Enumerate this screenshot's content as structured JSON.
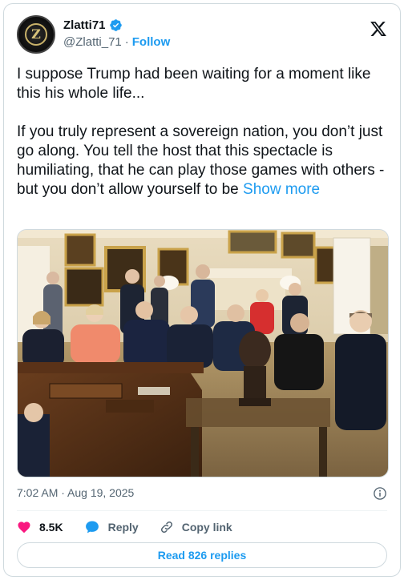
{
  "author": {
    "display_name": "Zlatti71",
    "handle": "@Zlatti_71",
    "separator": "·",
    "follow_label": "Follow",
    "avatar_letter": "Z"
  },
  "tweet": {
    "text": "I suppose Trump had been waiting for a moment like this his whole life...\n\nIf you truly represent a sovereign nation, you don’t just go along. You tell the host that this spectacle is humiliating, that he can play those games with others - but you don’t allow yourself to be ",
    "show_more_label": "Show more",
    "timestamp": "7:02 AM · Aug 19, 2025"
  },
  "actions": {
    "likes": "8.5K",
    "reply_label": "Reply",
    "copy_link_label": "Copy link"
  },
  "read_replies_label": "Read 826 replies",
  "colors": {
    "accent": "#1d9bf0",
    "like": "#f91880",
    "muted": "#536471",
    "text": "#0f1419"
  },
  "icons": [
    "verified-badge-icon",
    "x-logo-icon",
    "info-icon",
    "heart-icon",
    "reply-bubble-icon",
    "link-icon"
  ]
}
